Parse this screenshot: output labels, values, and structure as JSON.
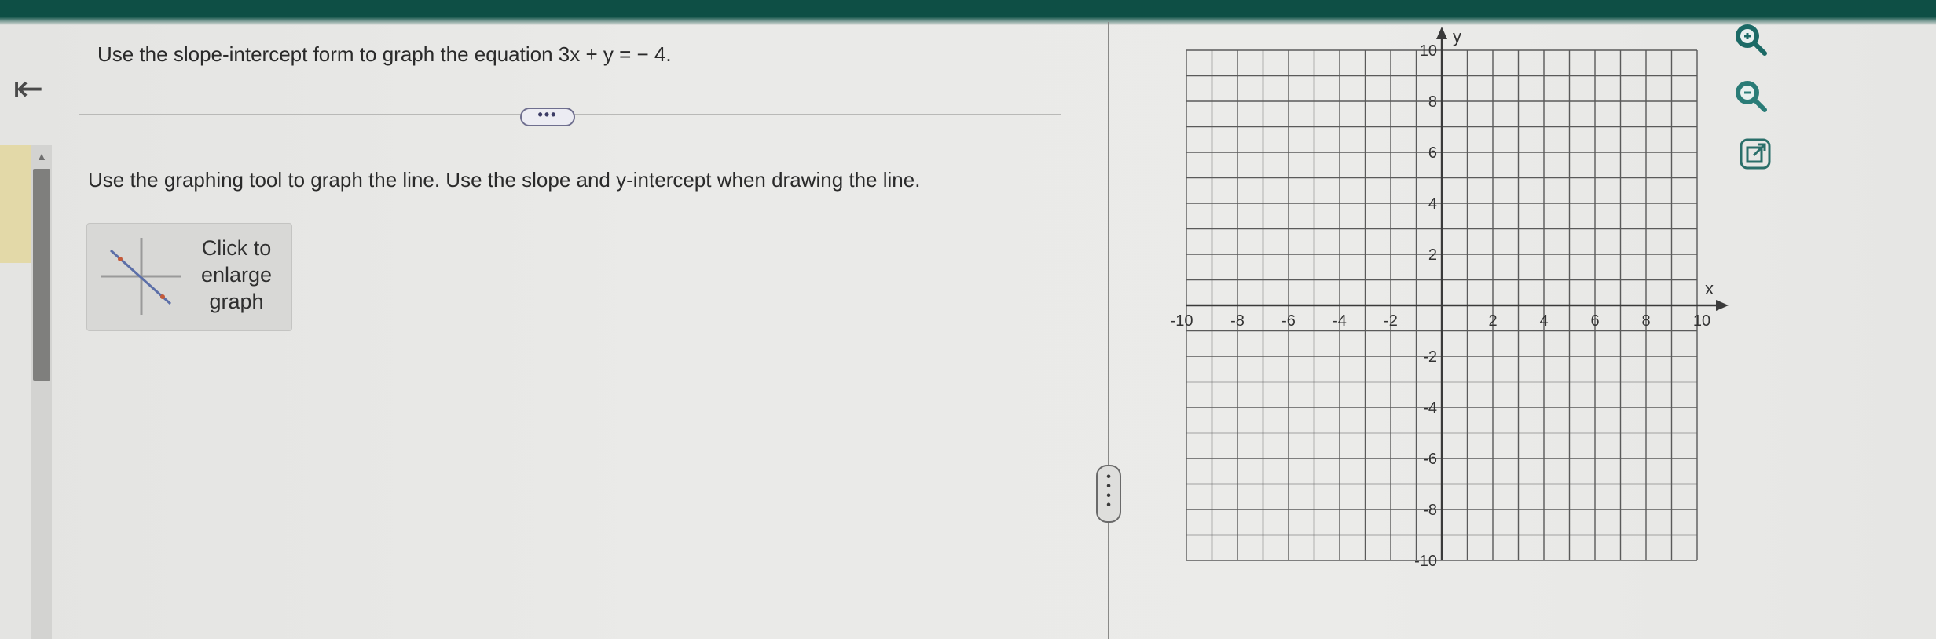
{
  "navigation": {
    "back_label": "⇤"
  },
  "question": {
    "prompt": "Use the slope-intercept form to graph the equation 3x + y = − 4.",
    "more_label": "•••",
    "instruction": "Use the graphing tool to graph the line. Use the slope and y-intercept when drawing the line."
  },
  "enlarge": {
    "line1": "Click to",
    "line2": "enlarge",
    "line3": "graph"
  },
  "pane_handle": {
    "label": "⋮"
  },
  "graph": {
    "x_axis_label": "x",
    "y_axis_label": "y",
    "x_range": [
      -10,
      10
    ],
    "y_range": [
      -10,
      10
    ],
    "grid_step": 1,
    "x_tick_labels": [
      "-10",
      "-8",
      "-6",
      "-4",
      "-2",
      "2",
      "4",
      "6",
      "8",
      "10"
    ],
    "x_tick_values": [
      -10,
      -8,
      -6,
      -4,
      -2,
      2,
      4,
      6,
      8,
      10
    ],
    "y_tick_labels": [
      "10",
      "8",
      "6",
      "4",
      "2",
      "-2",
      "-4",
      "-6",
      "-8",
      "-10"
    ],
    "y_tick_values": [
      10,
      8,
      6,
      4,
      2,
      -2,
      -4,
      -6,
      -8,
      -10
    ]
  },
  "tools": {
    "zoom_in": "zoom-in-icon",
    "zoom_out": "zoom-out-icon",
    "open_new": "external-link-icon"
  },
  "colors": {
    "banner": "#0e4f45",
    "grid_line": "#5a5a5a",
    "axis": "#3a3a3a",
    "zoom_in_fill": "#1c6a66",
    "zoom_out_fill": "#2a7c77"
  }
}
